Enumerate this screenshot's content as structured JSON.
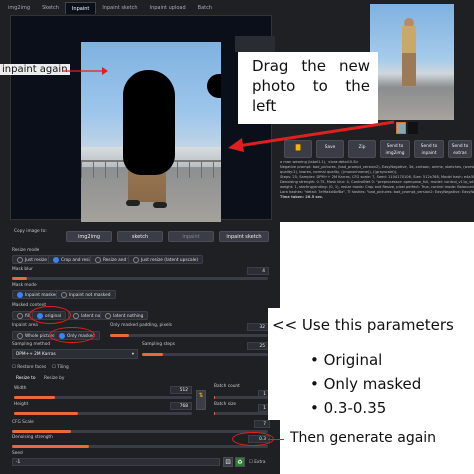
{
  "tabs": [
    "img2img",
    "Sketch",
    "Inpaint",
    "Inpaint sketch",
    "Inpaint upload",
    "Batch"
  ],
  "active_tab": "Inpaint",
  "copy_image_to": {
    "label": "Copy image to:",
    "buttons": [
      "img2img",
      "sketch",
      "inpaint",
      "inpaint sketch"
    ]
  },
  "resize_mode": {
    "label": "Resize mode",
    "options": [
      "Just resize",
      "Crop and resize",
      "Resize and fill",
      "Just resize (latent upscale)"
    ],
    "selected": "Crop and resize"
  },
  "mask_blur": {
    "label": "Mask blur",
    "value": "4"
  },
  "mask_mode": {
    "label": "Mask mode",
    "options": [
      "Inpaint masked",
      "Inpaint not masked"
    ],
    "selected": "Inpaint masked"
  },
  "masked_content": {
    "label": "Masked content",
    "options": [
      "fill",
      "original",
      "latent noise",
      "latent nothing"
    ],
    "selected": "original"
  },
  "inpaint_area": {
    "label": "Inpaint area",
    "options": [
      "Whole picture",
      "Only masked"
    ],
    "selected": "Only masked"
  },
  "only_masked_padding": {
    "label": "Only masked padding, pixels",
    "value": "32"
  },
  "sampling_method": {
    "label": "Sampling method",
    "value": "DPM++ 2M Karras"
  },
  "sampling_steps": {
    "label": "Sampling steps",
    "value": "25"
  },
  "checkboxes": [
    "Restore faces",
    "Tiling"
  ],
  "resize_tabs": [
    "Resize to",
    "Resize by"
  ],
  "width": {
    "label": "Width",
    "value": "512"
  },
  "height": {
    "label": "Height",
    "value": "768"
  },
  "batch_count": {
    "label": "Batch count",
    "value": "1"
  },
  "batch_size": {
    "label": "Batch size",
    "value": "1"
  },
  "cfg_scale": {
    "label": "CFG Scale",
    "value": "7"
  },
  "denoising": {
    "label": "Denoising strength",
    "value": "0.3"
  },
  "seed": {
    "label": "Seed",
    "value": "-1",
    "extra": "Extra"
  },
  "output_buttons": [
    {
      "label": "Save"
    },
    {
      "label": "Zip"
    },
    {
      "label": "Send to img2img"
    },
    {
      "label": "Send to inpaint"
    },
    {
      "label": "Send to extras"
    }
  ],
  "info_lines": [
    "a man wearing (label1.1), <lora:detail:0.8>",
    "Negative prompt: bad_pictures, (bad_prompt_version2), EasyNegative, 3d, cartoon, anime, sketches, (worst quality:2), (low quality:2), (normal",
    "quality:2), lowres, normal quality, ((monochrome)), ((grayscale)),",
    "Steps: 25, Sampler: DPM++ 2M Karras, CFG scale: 7, Seed: 1104170106, Size: 512x768, Model hash: e4a30e4607, Model: realisticVisionV20",
    "Denoising strength: 0.75, Mask blur: 4, ControlNet 0: \"preprocessor: openpose_full, model: control_v11p_sd15_openpose [cab727d4],",
    "weight: 1, starting/ending: (0, 1), resize mode: Crop and Resize, pixel perfect: True, control mode: Balanced, preprocessor params: (512, 64, 64)\",",
    "Lora hashes: \"detail: 7e9fa4d4bf8a\", TI hashes: \"bad_pictures: bad_prompt_version2: EasyNegative: EasyNegative: 1fd1...\"",
    "",
    "Time taken: 26.5 sec."
  ],
  "annotations": {
    "inpaint_again": "inpaint again",
    "drag_text": "Drag the new photo to the left",
    "params_title": "<< Use this parameters",
    "params": [
      "Original",
      "Only masked",
      "0.3-0.35"
    ],
    "generate": "Then generate again"
  },
  "colors": {
    "ui_bg": "#1f2023",
    "accent_orange": "#e86a3a",
    "selected_blue": "#3b82f6",
    "annotation_red": "#e02020"
  }
}
